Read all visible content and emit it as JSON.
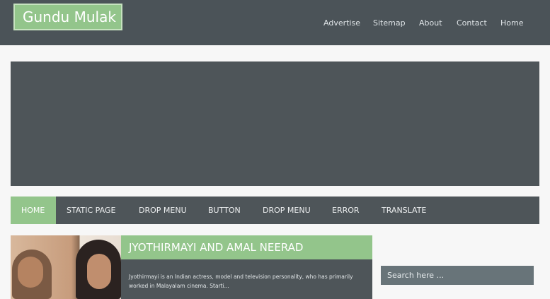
{
  "site": {
    "title": "Gundu Mulak"
  },
  "top_nav": [
    "Advertise",
    "Sitemap",
    "About",
    "Contact",
    "Home"
  ],
  "main_nav": [
    "HOME",
    "STATIC PAGE",
    "DROP MENU",
    "BUTTON",
    "DROP MENU",
    "ERROR",
    "TRANSLATE"
  ],
  "post": {
    "title": "JYOTHIRMAYI AND AMAL NEERAD",
    "excerpt": "Jyothirmayi is an Indian actress, model and television personality, who has primarily worked in Malayalam cinema. Starti..."
  },
  "search": {
    "placeholder": "Search here ..."
  },
  "colors": {
    "accent": "#93c58b",
    "dark": "#4e5559",
    "header": "#4b5358"
  }
}
